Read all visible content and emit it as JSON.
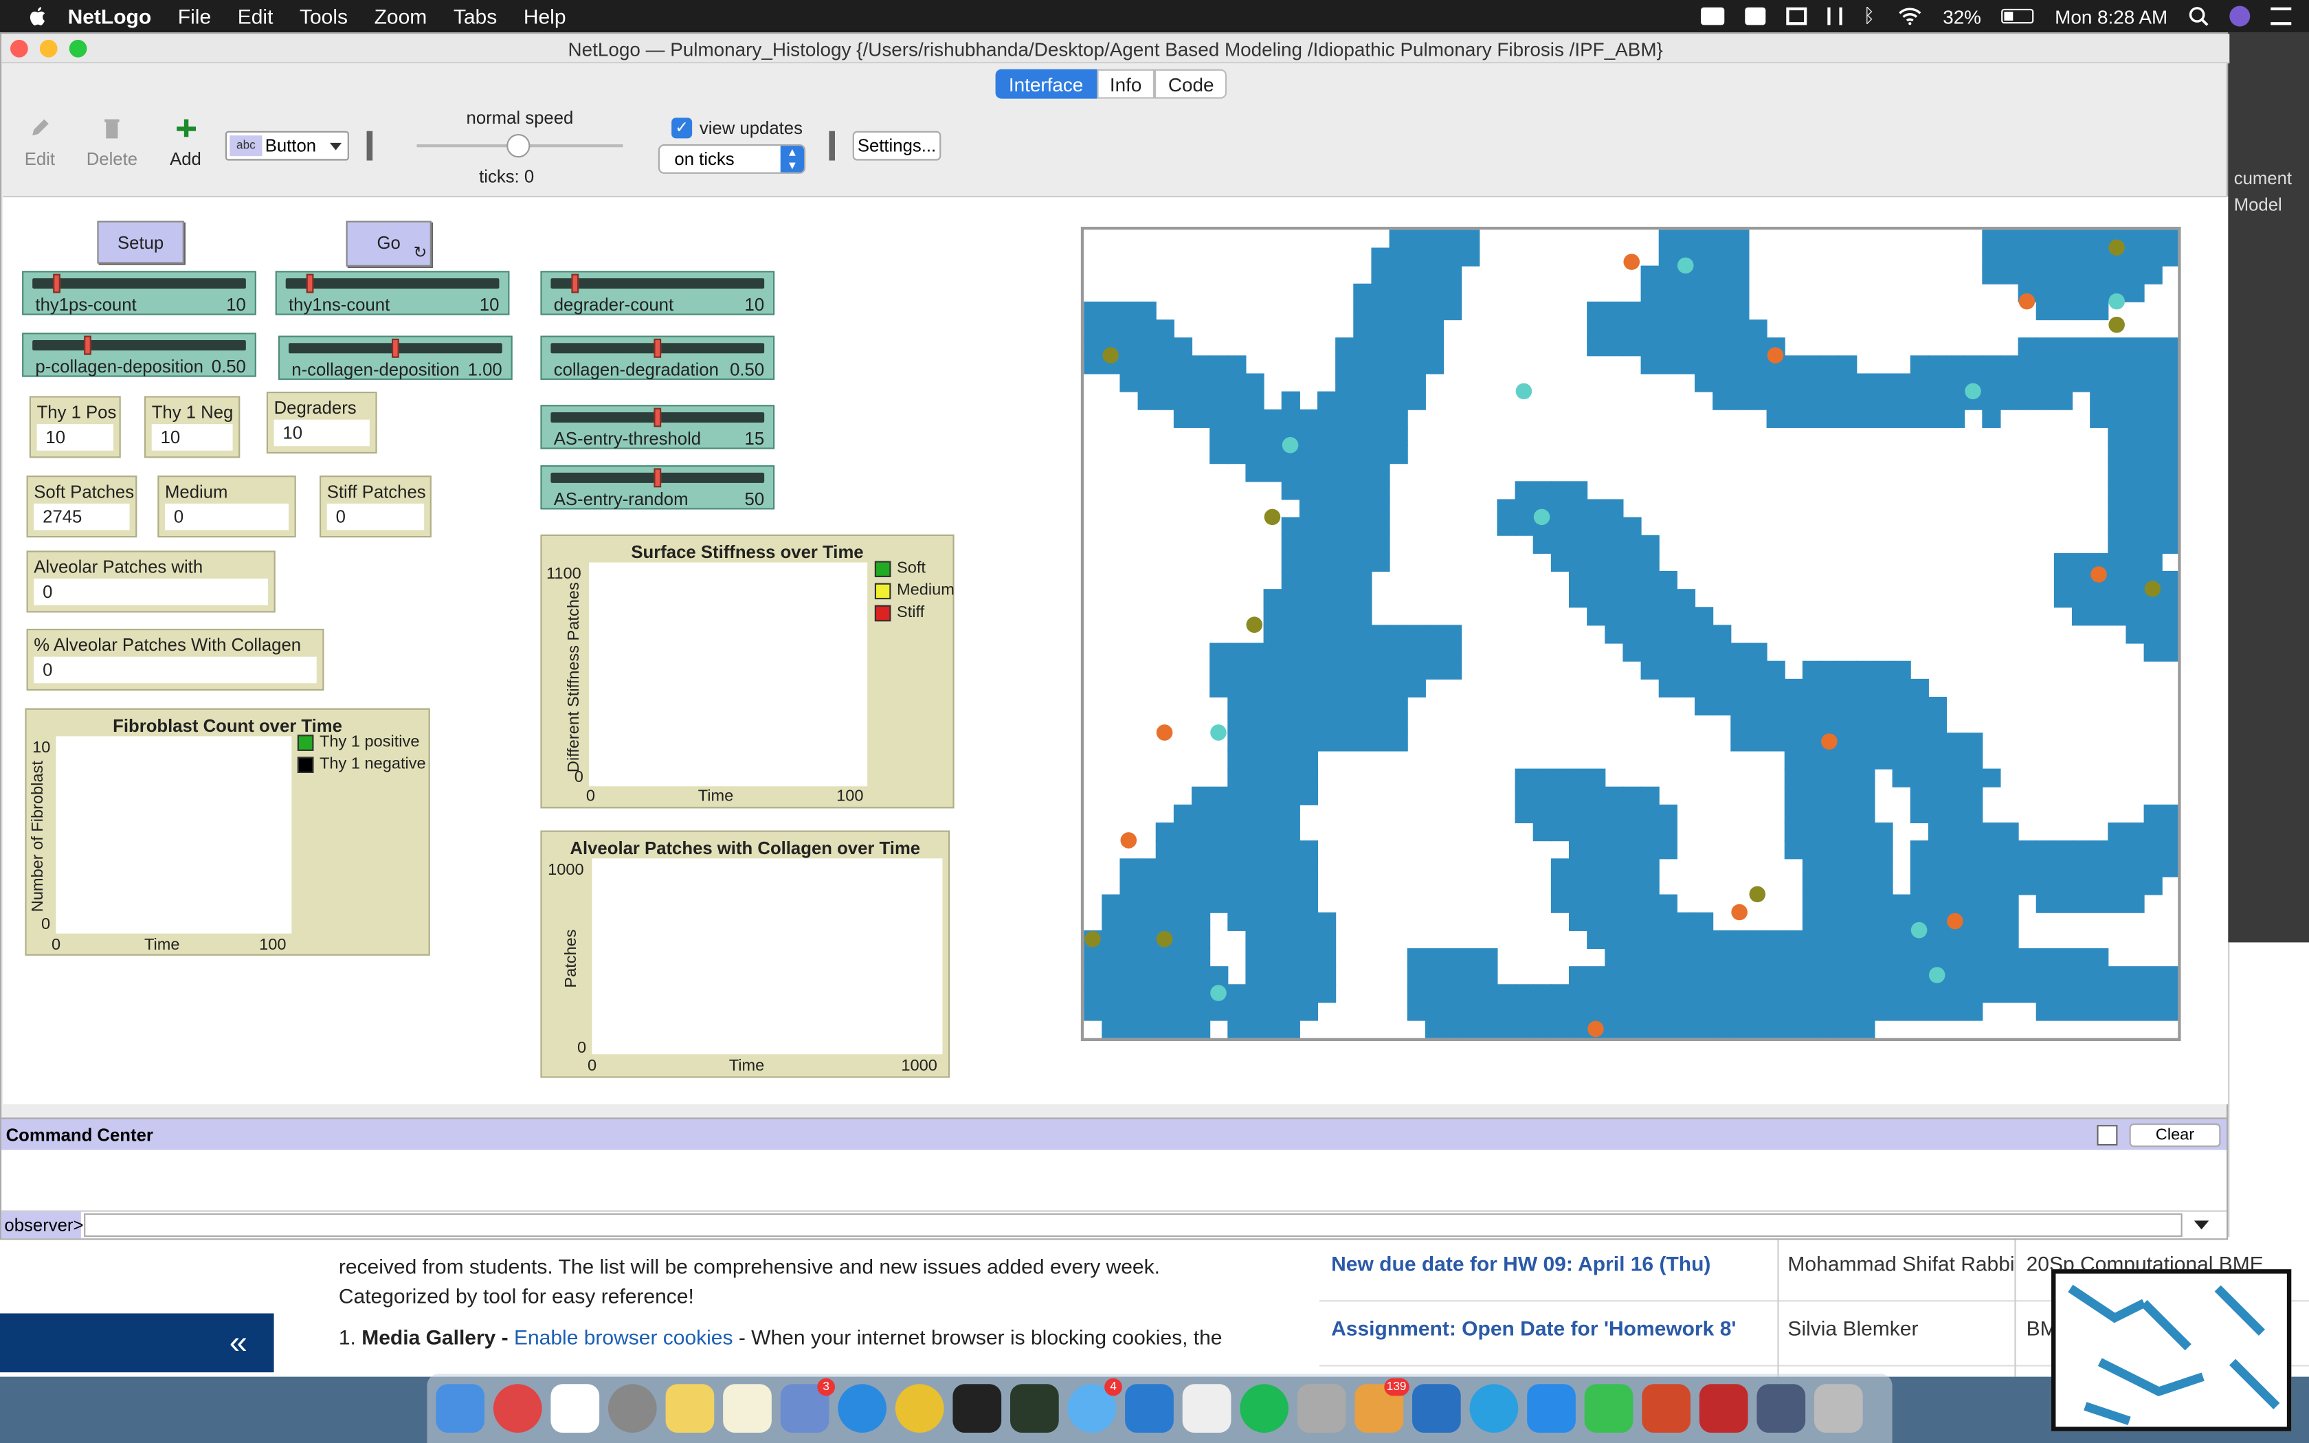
{
  "menubar": {
    "app": "NetLogo",
    "items": [
      "File",
      "Edit",
      "Tools",
      "Zoom",
      "Tabs",
      "Help"
    ],
    "battery": "32%",
    "clock": "Mon 8:28 AM"
  },
  "window": {
    "title": "NetLogo — Pulmonary_Histology {/Users/rishubhanda/Desktop/Agent Based Modeling /Idiopathic Pulmonary Fibrosis /IPF_ABM}"
  },
  "tabs": [
    "Interface",
    "Info",
    "Code"
  ],
  "toolbar": {
    "edit": "Edit",
    "delete": "Delete",
    "add": "Add",
    "widget_type": "Button",
    "widget_icon_text": "abc",
    "speed_label": "normal speed",
    "ticks": "ticks: 0",
    "view_updates": "view updates",
    "update_mode": "on ticks",
    "settings": "Settings..."
  },
  "buttons": {
    "setup": "Setup",
    "go": "Go"
  },
  "sliders": [
    {
      "name": "thy1ps-count",
      "value": "10",
      "level": 0.1
    },
    {
      "name": "thy1ns-count",
      "value": "10",
      "level": 0.1
    },
    {
      "name": "degrader-count",
      "value": "10",
      "level": 0.1
    },
    {
      "name": "p-collagen-deposition",
      "value": "0.50",
      "level": 0.25
    },
    {
      "name": "n-collagen-deposition",
      "value": "1.00",
      "level": 0.5
    },
    {
      "name": "collagen-degradation",
      "value": "0.50",
      "level": 0.5
    },
    {
      "name": "AS-entry-threshold",
      "value": "15",
      "level": 0.5
    },
    {
      "name": "AS-entry-random",
      "value": "50",
      "level": 0.5
    }
  ],
  "monitors": [
    {
      "label": "Thy 1 Pos",
      "value": "10"
    },
    {
      "label": "Thy 1 Neg",
      "value": "10"
    },
    {
      "label": "Degraders",
      "value": "10"
    },
    {
      "label": "Soft Patches",
      "value": "2745"
    },
    {
      "label": "Medium Patches",
      "value": "0"
    },
    {
      "label": "Stiff Patches",
      "value": "0"
    },
    {
      "label": "Alveolar Patches with Collagen",
      "value": "0"
    },
    {
      "label": "% Alveolar Patches With Collagen",
      "value": "0"
    }
  ],
  "plots": {
    "fibroblast": {
      "title": "Fibroblast Count over Time",
      "ylabel": "Number of Fibroblast",
      "xlabel": "Time",
      "ymax": "10",
      "ymin": "0",
      "xmin": "0",
      "xmax": "100",
      "legend": [
        {
          "name": "Thy 1 positive",
          "color": "#22aa22"
        },
        {
          "name": "Thy 1 negative",
          "color": "#000000"
        }
      ]
    },
    "stiffness": {
      "title": "Surface Stiffness over Time",
      "ylabel": "Different Stiffness Patches",
      "xlabel": "Time",
      "ymax": "1100",
      "ymin": "0",
      "xmin": "0",
      "xmax": "100",
      "legend": [
        {
          "name": "Soft",
          "color": "#22aa22"
        },
        {
          "name": "Medium",
          "color": "#f0f030"
        },
        {
          "name": "Stiff",
          "color": "#dd2222"
        }
      ]
    },
    "alveolar": {
      "title": "Alveolar Patches with Collagen over Time",
      "ylabel": "Patches",
      "xlabel": "Time",
      "ymax": "1000",
      "ymin": "0",
      "xmin": "0",
      "xmax": "1000"
    }
  },
  "world": {
    "colors": {
      "tissue": "#2e8bc0",
      "empty": "#ffffff",
      "thy1_pos": "#e8702a",
      "thy1_neg": "#5ed0c8",
      "degrader": "#8a8a20"
    }
  },
  "command_center": {
    "title": "Command Center",
    "clear": "Clear",
    "prompt": "observer>"
  },
  "background": {
    "article_line1": "received from students.  The list will be comprehensive and new issues added every week.",
    "article_line2": "Categorized by tool for easy reference!",
    "article_item_prefix": "1.",
    "article_item_title": "Media Gallery -",
    "article_item_link": "Enable browser cookies",
    "article_item_text": "- When your internet browser is blocking cookies, the",
    "collapse": "«",
    "rows": [
      {
        "title": "New due date for HW 09: April 16 (Thu)",
        "name": "Mohammad Shifat Rabbi",
        "course": "20Sp Computational BME"
      },
      {
        "title": "Assignment: Open Date for 'Homework 8'",
        "name": "Silvia Blemker",
        "course": "BME"
      }
    ],
    "right_window_labels": [
      "cument",
      "Model"
    ]
  },
  "dock_badges": [
    "3",
    "4",
    "139"
  ]
}
